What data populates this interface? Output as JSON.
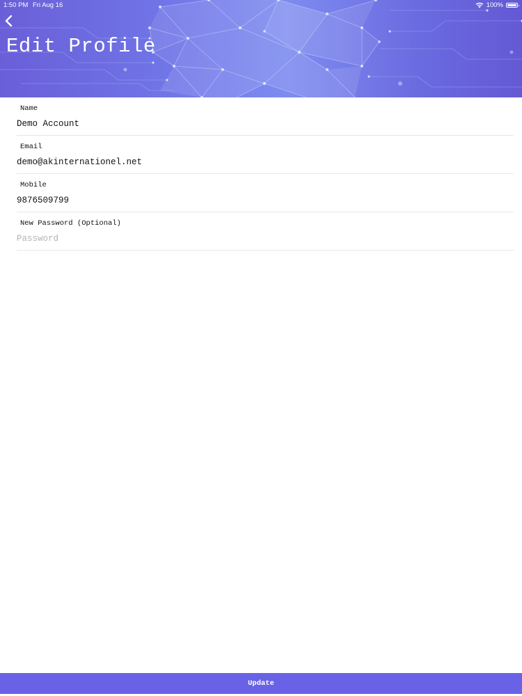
{
  "status_bar": {
    "time": "1:50 PM",
    "date": "Fri Aug 16",
    "battery": "100%",
    "icons": [
      "wifi-icon",
      "battery-icon"
    ]
  },
  "header": {
    "title": "Edit Profile",
    "back_icon": "chevron-left-icon",
    "colors": {
      "gradient_start": "#6a5fd8",
      "gradient_mid": "#7d8cf0",
      "gradient_end": "#6359d4"
    }
  },
  "form": {
    "fields": [
      {
        "label": "Name",
        "value": "Demo Account",
        "placeholder": ""
      },
      {
        "label": "Email",
        "value": "demo@akinternationel.net",
        "placeholder": ""
      },
      {
        "label": "Mobile",
        "value": "9876509799",
        "placeholder": ""
      },
      {
        "label": "New Password (Optional)",
        "value": "",
        "placeholder": "Password"
      }
    ]
  },
  "footer": {
    "update_label": "Update",
    "accent_color": "#6962e6"
  }
}
